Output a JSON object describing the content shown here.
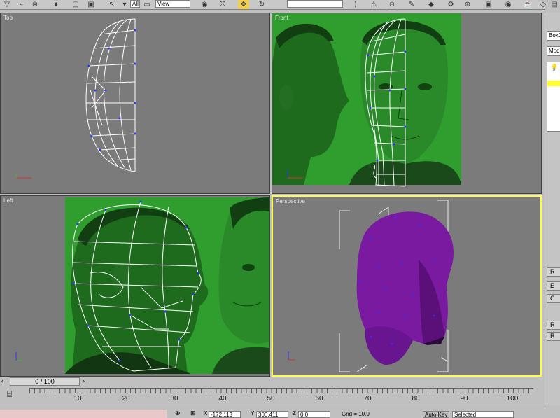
{
  "toolbar": {
    "filter_value": "All",
    "coord_value": "View"
  },
  "viewports": {
    "top": {
      "label": "Top"
    },
    "front": {
      "label": "Front"
    },
    "left": {
      "label": "Left"
    },
    "perspective": {
      "label": "Perspective"
    }
  },
  "command_panel": {
    "name_field": "Box0",
    "modifier_list": "Mod",
    "buttons": [
      "R",
      "E",
      "C",
      "R",
      "R"
    ]
  },
  "time_slider": {
    "position": "0 / 100",
    "frame_fraction": 0.0
  },
  "track_bar": {
    "ticks": [
      "10",
      "20",
      "30",
      "40",
      "50",
      "60",
      "70",
      "80",
      "90",
      "100"
    ]
  },
  "status_bar": {
    "x_value": "-172.113",
    "y_value": "300.411",
    "z_value": "0.0",
    "grid": "Grid = 10.0",
    "auto_key": "Auto Key",
    "selected": "Selected"
  },
  "colors": {
    "viewport_bg": "#7b7b7b",
    "active_border": "#ffff40",
    "reference_green": "#2f9e2f",
    "mesh_purple": "#7a1aa0"
  }
}
